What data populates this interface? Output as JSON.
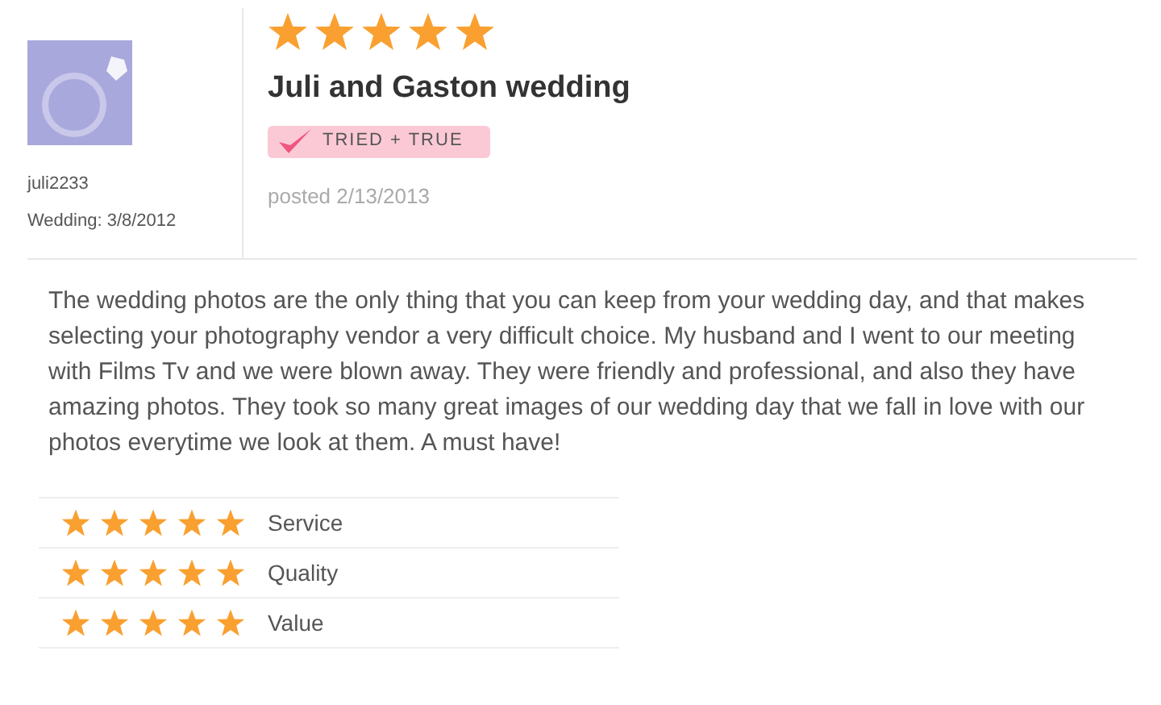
{
  "reviewer": {
    "username": "juli2233",
    "wedding_date": "Wedding: 3/8/2012"
  },
  "review": {
    "stars": 5,
    "title": "Juli and Gaston wedding",
    "badge": "TRIED + TRUE",
    "posted": "posted 2/13/2013",
    "body": "The wedding photos are the only thing that you can keep from your wedding day, and that makes selecting your photography vendor a very difficult choice. My husband and I went to our meeting with Films Tv and we were blown away. They were friendly and professional, and also they have amazing photos. They took so many great images of our wedding day that we fall in love with our photos everytime we look at them. A must have!"
  },
  "ratings": [
    {
      "label": "Service",
      "stars": 5
    },
    {
      "label": "Quality",
      "stars": 5
    },
    {
      "label": "Value",
      "stars": 5
    }
  ]
}
